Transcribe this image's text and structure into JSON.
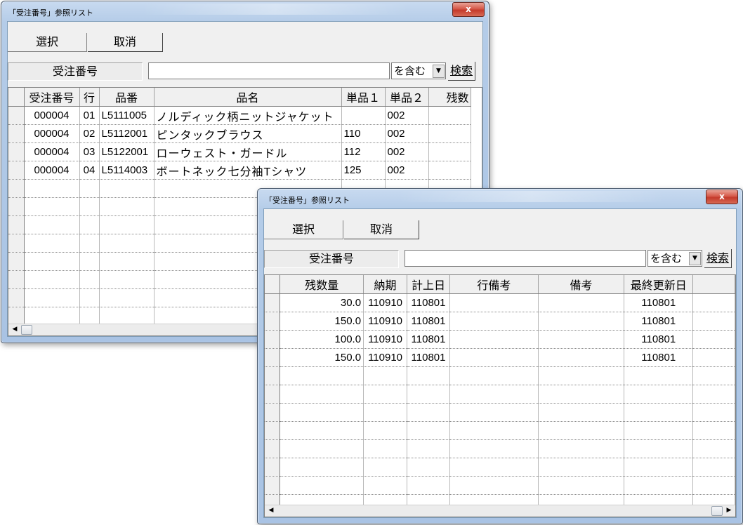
{
  "window1": {
    "title": "「受注番号」参照リスト",
    "close_label": "x",
    "select_label": "選択",
    "cancel_label": "取消",
    "field_label": "受注番号",
    "search_value": "",
    "match_mode": "を含む",
    "search_label": "検索",
    "columns": [
      "受注番号",
      "行",
      "品番",
      "品名",
      "単品１",
      "単品２",
      "残数"
    ],
    "rows": [
      [
        "000004",
        "01",
        "L5111005",
        "ノルディック柄ニットジャケット",
        "",
        "002",
        ""
      ],
      [
        "000004",
        "02",
        "L5112001",
        "ピンタックブラウス",
        "110",
        "002",
        ""
      ],
      [
        "000004",
        "03",
        "L5122001",
        "ローウェスト・ガードル",
        "112",
        "002",
        ""
      ],
      [
        "000004",
        "04",
        "L5114003",
        "ボートネック七分袖Tシャツ",
        "125",
        "002",
        ""
      ]
    ]
  },
  "window2": {
    "title": "「受注番号」参照リスト",
    "close_label": "x",
    "select_label": "選択",
    "cancel_label": "取消",
    "field_label": "受注番号",
    "search_value": "",
    "match_mode": "を含む",
    "search_label": "検索",
    "columns": [
      "残数量",
      "納期",
      "計上日",
      "行備考",
      "備考",
      "最終更新日"
    ],
    "rows": [
      [
        "30.0",
        "110910",
        "110801",
        "",
        "",
        "110801"
      ],
      [
        "150.0",
        "110910",
        "110801",
        "",
        "",
        "110801"
      ],
      [
        "100.0",
        "110910",
        "110801",
        "",
        "",
        "110801"
      ],
      [
        "150.0",
        "110910",
        "110801",
        "",
        "",
        "110801"
      ]
    ]
  },
  "icons": {
    "dropdown_arrow": "chevron-down-icon",
    "scroll_left": "arrow-left-icon",
    "scroll_right": "arrow-right-icon"
  }
}
